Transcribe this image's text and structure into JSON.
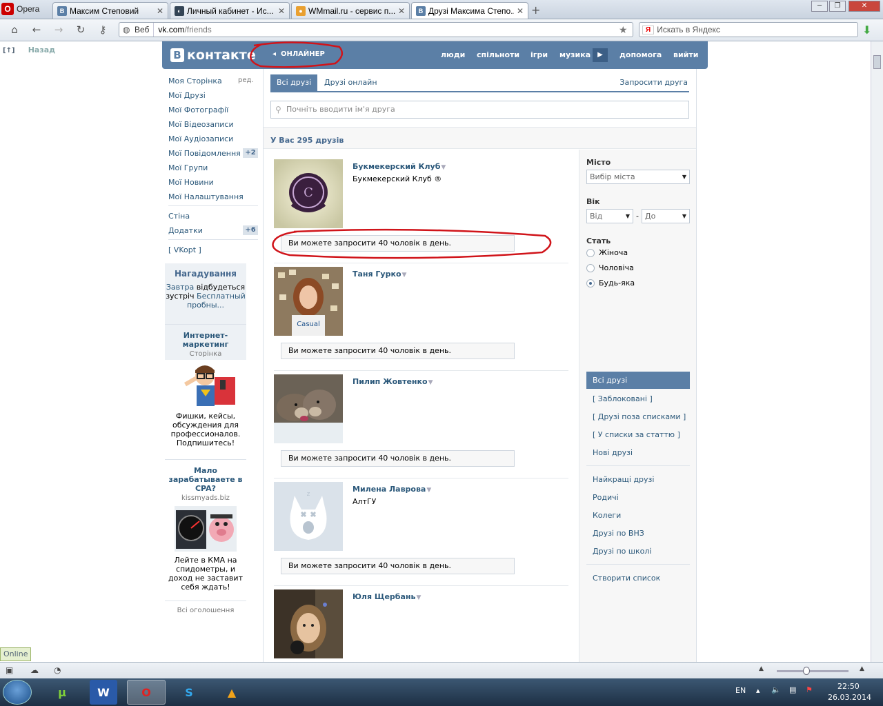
{
  "browser": {
    "menu_label": "Opera",
    "tabs": [
      {
        "title": "Максим Степовий",
        "icon": "vk-icon"
      },
      {
        "title": "Личный кабинет - Ис...",
        "icon": "globe-icon"
      },
      {
        "title": "WMmail.ru - сервис п...",
        "icon": "wmmail-icon"
      },
      {
        "title": "Друзі Максима Степо...",
        "icon": "vk-icon"
      }
    ],
    "address_prefix": "Веб",
    "address_host": "vk.com",
    "address_path": "/friends",
    "search_placeholder": "Искать в Яндекс",
    "back_link": "Назад"
  },
  "header": {
    "logo": "контакте",
    "logo_letter": "В",
    "online_label": "ОНЛАЙНЕР",
    "nav": [
      "люди",
      "спільноти",
      "ігри",
      "музика",
      "допомога",
      "вийти"
    ]
  },
  "left_menu": {
    "items": [
      "Моя Сторінка",
      "Мої Друзі",
      "Мої Фотографії",
      "Мої Відеозаписи",
      "Мої Аудіозаписи",
      "Мої Повідомлення",
      "Мої Групи",
      "Мої Новини",
      "Мої Налаштування"
    ],
    "edit_label": "ред.",
    "messages_badge": "+2",
    "extra": [
      "Стіна",
      "Додатки"
    ],
    "apps_badge": "+6",
    "vkopt": "[ VKopt ]"
  },
  "reminder": {
    "title": "Нагадування",
    "link1": "Завтра",
    "text": "відбудеться зустріч",
    "link2": "Бесплатный пробны..."
  },
  "ads": [
    {
      "title": "Интернет-маркетинг",
      "sub": "Сторінка",
      "text": "Фишки, кейсы, обсуждения для профессионалов. Подпишитесь!"
    },
    {
      "title": "Мало зарабатываете в CPA?",
      "sub": "kissmyads.biz",
      "text": "Лейте в КМА на спидометры, и доход не заставит себя ждать!"
    }
  ],
  "all_ads": "Всі оголошення",
  "friends_page": {
    "tab_all": "Всі друзі",
    "tab_online": "Друзі онлайн",
    "invite": "Запросити друга",
    "search_placeholder": "Почніть вводити ім'я друга",
    "count_text": "У Вас 295 друзів",
    "limit_text": "Ви можете запросити 40 чоловік в день.",
    "friends": [
      {
        "name": "Букмекерский Клуб",
        "sub": "Букмекерский Клуб ®"
      },
      {
        "name": "Таня Гурко",
        "sub": ""
      },
      {
        "name": "Пилип Жовтенко",
        "sub": ""
      },
      {
        "name": "Милена Лаврова",
        "sub": "АлтГУ"
      },
      {
        "name": "Юля Щербань",
        "sub": ""
      }
    ]
  },
  "filters": {
    "city_label": "Місто",
    "city_select": "Вибір міста",
    "age_label": "Вік",
    "age_from": "Від",
    "age_dash": "-",
    "age_to": "До",
    "sex_label": "Стать",
    "sex_options": [
      "Жіноча",
      "Чоловіча",
      "Будь-яка"
    ],
    "sex_selected": 2,
    "lists_selected": "Всі друзі",
    "lists": [
      "[ Заблоковані ]",
      "[ Друзі поза списками ]",
      "[ У списки за статтю ]",
      "Нові друзі"
    ],
    "groups": [
      "Найкращі друзі",
      "Родичі",
      "Колеги",
      "Друзі по ВНЗ",
      "Друзі по школі"
    ],
    "create_list": "Створити список"
  },
  "status": {
    "online": "Online"
  },
  "taskbar": {
    "lang": "EN",
    "time": "22:50",
    "date": "26.03.2014"
  },
  "colors": {
    "vk_blue": "#5b7fa6",
    "link": "#2b587a",
    "annotation_red": "#d0141a"
  }
}
